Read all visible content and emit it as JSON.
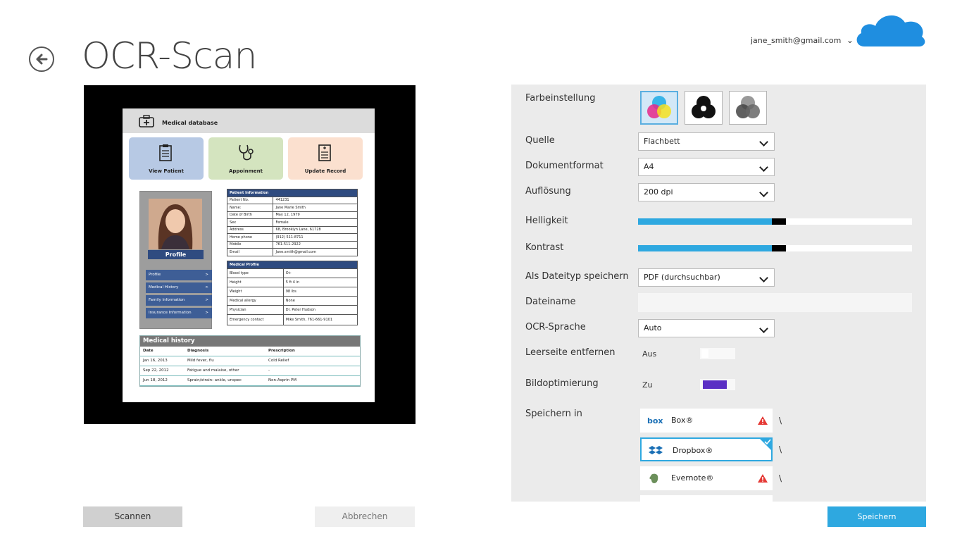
{
  "header": {
    "title": "OCR-Scan",
    "account_email": "jane_smith@gmail.com",
    "account_chevron": "⌄"
  },
  "preview": {
    "doc_title": "Medical database",
    "tiles": [
      {
        "label": "View Patient",
        "color": "#b7c9e4"
      },
      {
        "label": "Appoinment",
        "color": "#d4e4bf"
      },
      {
        "label": "Update Record",
        "color": "#fbe0cf"
      }
    ],
    "profile_label": "Profile",
    "profile_menu": [
      "Profile",
      "Medical History",
      "Family Information",
      "Insurance Information"
    ],
    "menu_arrow": ">",
    "patient_info": {
      "heading": "Patient Information",
      "rows": [
        [
          "Patient No.",
          "441231"
        ],
        [
          "Name:",
          "Jane Marie Smith"
        ],
        [
          "Date of Birth",
          "May 12, 1979"
        ],
        [
          "Sex",
          "Female"
        ],
        [
          "Address",
          "68, Brooklyn Lane, 61728"
        ],
        [
          "Home phone",
          "(912) 511-8711"
        ],
        [
          "Mobile",
          "761-511-2922"
        ],
        [
          "Email",
          "Jane.smith@gmail.com"
        ]
      ]
    },
    "medical_profile": {
      "heading": "Medical Profile",
      "rows": [
        [
          "Blood type",
          "O+"
        ],
        [
          "Height",
          "5 ft 4 in"
        ],
        [
          "Weight",
          "98 lbs"
        ],
        [
          "Medical allergy",
          "None"
        ],
        [
          "Physician",
          "Dr. Peter Hudson"
        ],
        [
          "Emergency contact",
          "Mike Smith, 761-661-9101"
        ]
      ]
    },
    "history": {
      "heading": "Medical history",
      "columns": [
        "Date",
        "Diagnosis",
        "Prescription"
      ],
      "rows": [
        [
          "Jan 16, 2013",
          "Mild fever, flu",
          "Cold Relief"
        ],
        [
          "Sep 22, 2012",
          "Fatigue and malaise, other",
          "-"
        ],
        [
          "Jun 18, 2012",
          "Sprain/strain: ankle, unspec",
          "Non-Asprin PM"
        ]
      ]
    }
  },
  "settings": {
    "color_label": "Farbeinstellung",
    "source_label": "Quelle",
    "source_value": "Flachbett",
    "format_label": "Dokumentformat",
    "format_value": "A4",
    "resolution_label": "Auflösung",
    "resolution_value": "200 dpi",
    "brightness_label": "Helligkeit",
    "brightness_level": 0.5,
    "contrast_label": "Kontrast",
    "contrast_level": 0.5,
    "filetype_label": "Als Dateityp speichern",
    "filetype_value": "PDF (durchsuchbar)",
    "filename_label": "Dateiname",
    "filename_value": "",
    "ocr_lang_label": "OCR-Sprache",
    "ocr_lang_value": "Auto",
    "blank_page_label": "Leerseite entfernen",
    "blank_page_state": "Aus",
    "optimize_label": "Bildoptimierung",
    "optimize_state": "Zu",
    "save_in_label": "Speichern in",
    "services": [
      {
        "name": "Box®",
        "status": "warning",
        "tick": "\\"
      },
      {
        "name": "Dropbox®",
        "status": "selected",
        "tick": "\\"
      },
      {
        "name": "Evernote®",
        "status": "warning",
        "tick": "\\"
      }
    ],
    "accent_color": "#2ea8e0",
    "toggle_on_color": "#5b2fc4"
  },
  "buttons": {
    "scan": "Scannen",
    "cancel": "Abbrechen",
    "save": "Speichern"
  }
}
